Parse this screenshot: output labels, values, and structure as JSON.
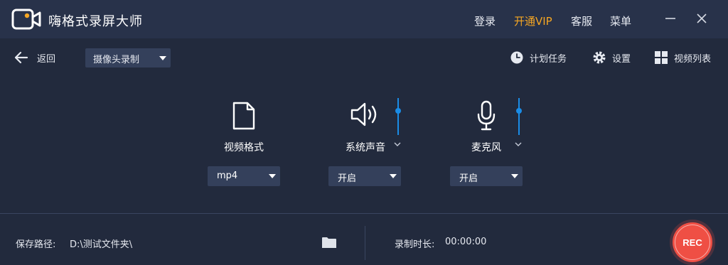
{
  "app": {
    "title": "嗨格式录屏大师",
    "accent_color": "#1a8ce6",
    "vip_color": "#f5a623",
    "rec_color": "#ef4f44"
  },
  "titlebar": {
    "login_label": "登录",
    "vip_label": "开通VIP",
    "service_label": "客服",
    "menu_label": "菜单",
    "minimize_icon": "minimize-icon",
    "close_icon": "close-icon"
  },
  "toolbar": {
    "back_label": "返回",
    "mode_select_value": "摄像头录制",
    "schedule_label": "计划任务",
    "settings_label": "设置",
    "video_list_label": "视频列表"
  },
  "settings": {
    "video_format": {
      "label": "视频格式",
      "icon": "file-icon",
      "value": "mp4"
    },
    "system_audio": {
      "label": "系统声音",
      "icon": "speaker-icon",
      "value": "开启",
      "volume_level": 0.25
    },
    "microphone": {
      "label": "麦克风",
      "icon": "microphone-icon",
      "value": "开启",
      "volume_level": 0.25
    }
  },
  "footer": {
    "save_path_label": "保存路径:",
    "save_path_value": "D:\\测试文件夹\\",
    "duration_label": "录制时长:",
    "duration_value": "00:00:00",
    "rec_label": "REC"
  }
}
